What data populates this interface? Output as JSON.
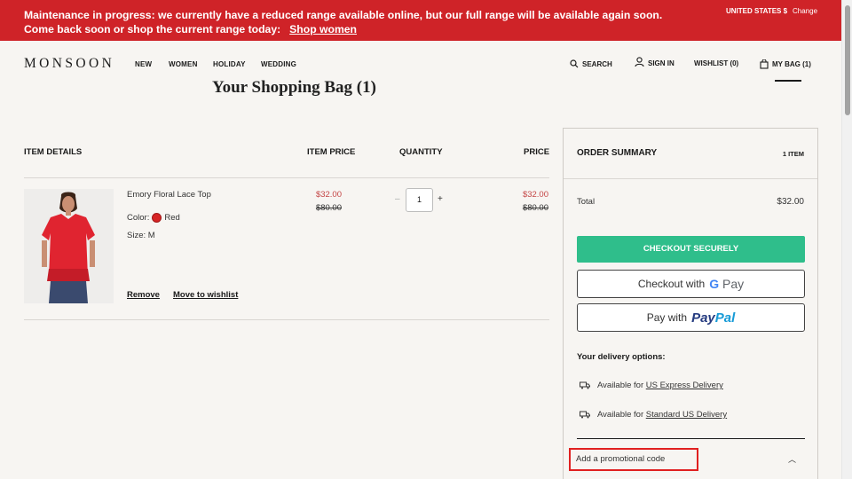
{
  "banner": {
    "line1": "Maintenance in progress: we currently have a reduced range available online, but our full range will be available again soon.",
    "line2": "Come back soon or shop the current range today:",
    "link": "Shop women",
    "country": "UNITED STATES $",
    "change": "Change",
    "color": "#cf2328"
  },
  "header": {
    "logo": "MONSOON",
    "nav": [
      "NEW",
      "WOMEN",
      "HOLIDAY",
      "WEDDING"
    ],
    "search": "SEARCH",
    "sign_in": "SIGN IN",
    "wishlist": "WISHLIST (0)",
    "bag": "MY BAG (1)"
  },
  "page_title": "Your Shopping Bag (1)",
  "table": {
    "headers": {
      "item_details": "ITEM DETAILS",
      "item_price": "ITEM PRICE",
      "quantity": "QUANTITY",
      "price": "PRICE"
    }
  },
  "item": {
    "name": "Emory Floral Lace Top",
    "color_label": "Color:",
    "color": "Red",
    "color_hex": "#d62424",
    "size": "Size: M",
    "price_sale": "$32.00",
    "price_original": "$80.00",
    "quantity": "1",
    "total_sale": "$32.00",
    "total_original": "$80.00",
    "remove": "Remove",
    "move_to_wishlist": "Move to wishlist"
  },
  "summary": {
    "title": "ORDER SUMMARY",
    "count": "1 ITEM",
    "total_label": "Total",
    "total_value": "$32.00",
    "checkout": "CHECKOUT SECURELY",
    "checkout_color": "#2fbe8b",
    "gpay_prefix": "Checkout with",
    "gpay_brand": "Pay",
    "paypal_prefix": "Pay with",
    "paypal_brand_1": "Pay",
    "paypal_brand_2": "Pal",
    "delivery_title": "Your delivery options:",
    "delivery": [
      {
        "prefix": "Available for",
        "link": "US Express Delivery"
      },
      {
        "prefix": "Available for",
        "link": "Standard US Delivery"
      }
    ],
    "promo": "Add a promotional code"
  }
}
